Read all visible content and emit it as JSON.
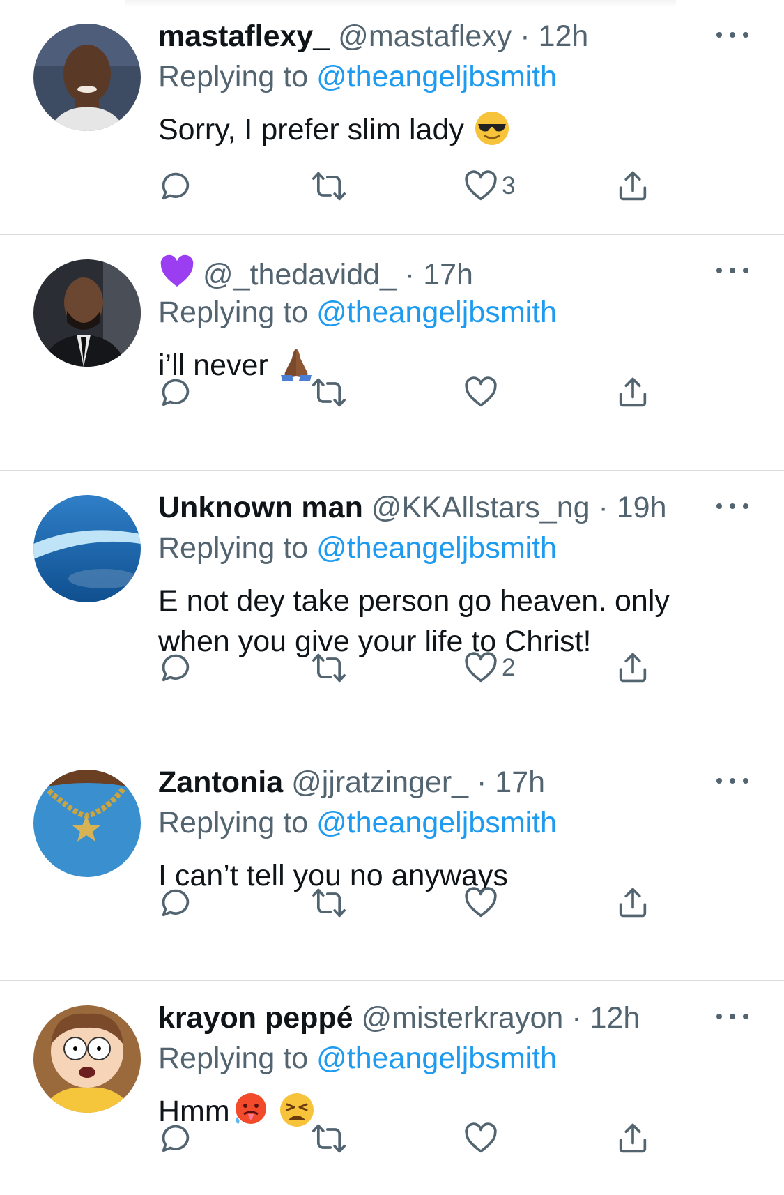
{
  "tweets": [
    {
      "name": "mastaflexy_",
      "handle": "@mastaflexy",
      "sep": "·",
      "time": "12h",
      "replying_label": "Replying to",
      "replying_handle": "@theangeljbsmith",
      "text": "Sorry, I prefer slim lady",
      "emoji": [
        "sunglasses-face"
      ],
      "likes": "3"
    },
    {
      "name": "",
      "name_emoji": "purple-heart",
      "handle": "@_thedavidd_",
      "sep": "·",
      "time": "17h",
      "replying_label": "Replying to",
      "replying_handle": "@theangeljbsmith",
      "text": "i’ll never",
      "emoji": [
        "folded-hands"
      ],
      "likes": ""
    },
    {
      "name": "Unknown man",
      "handle": "@KKAllstars_ng",
      "sep": "·",
      "time": "19h",
      "replying_label": "Replying to",
      "replying_handle": "@theangeljbsmith",
      "text": "E not dey take person go heaven. only when you give your life to Christ!",
      "emoji": [],
      "likes": "2"
    },
    {
      "name": "Zantonia",
      "handle": "@jjratzinger_",
      "sep": "·",
      "time": "17h",
      "replying_label": "Replying to",
      "replying_handle": "@theangeljbsmith",
      "text": "I can’t tell you no anyways",
      "emoji": [],
      "likes": ""
    },
    {
      "name": "krayon peppé",
      "handle": "@misterkrayon",
      "sep": "·",
      "time": "12h",
      "replying_label": "Replying to",
      "replying_handle": "@theangeljbsmith",
      "text": "Hmm",
      "emoji": [
        "hot-face",
        "tired-face"
      ],
      "likes": ""
    }
  ],
  "icons": {
    "reply": "reply-icon",
    "retweet": "retweet-icon",
    "like": "heart-icon",
    "share": "share-icon",
    "more": "more-icon"
  },
  "colors": {
    "link": "#1d9bf0",
    "secondary_text": "#536471",
    "divider": "#d9dde0"
  }
}
